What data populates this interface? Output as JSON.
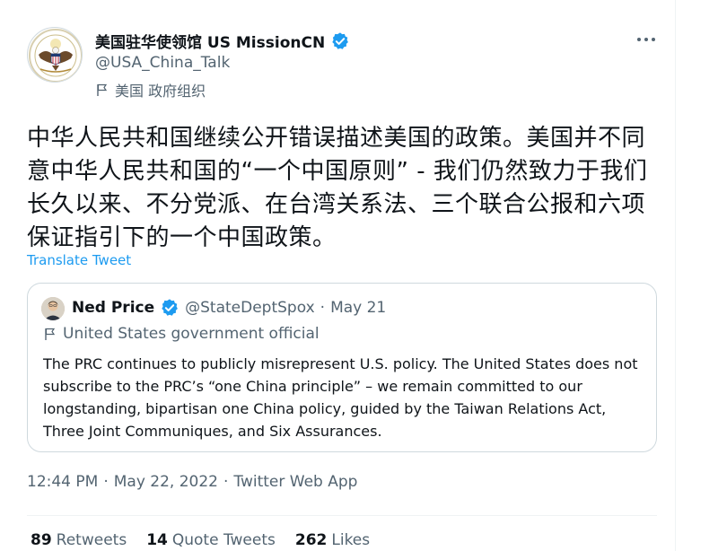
{
  "author": {
    "display_name": "美国驻华使领馆 US MissionCN",
    "handle": "@USA_China_Talk",
    "affiliation": "美国 政府组织"
  },
  "tweet": {
    "text": "中华人民共和国继续公开错误描述美国的政策。美国并不同意中华人民共和国的“一个中国原则” - 我们仍然致力于我们长久以来、不分党派、在台湾关系法、三个联合公报和六项保证指引下的一个中国政策。",
    "translate_label": "Translate Tweet",
    "time": "12:44 PM",
    "sep": "·",
    "date": "May 22, 2022",
    "source": "Twitter Web App"
  },
  "quote": {
    "display_name": "Ned Price",
    "handle": "@StateDeptSpox",
    "sep": "·",
    "date": "May 21",
    "affiliation": "United States government official",
    "text": "The PRC continues to publicly misrepresent U.S. policy. The United States does not subscribe to the PRC’s “one China principle” – we remain committed to our longstanding, bipartisan one China policy, guided by the Taiwan Relations Act, Three Joint Communiques, and Six Assurances."
  },
  "stats": {
    "retweets_count": "89",
    "retweets_label": "Retweets",
    "quotes_count": "14",
    "quotes_label": "Quote Tweets",
    "likes_count": "262",
    "likes_label": "Likes"
  },
  "colors": {
    "link": "#1d9bf0",
    "secondary_text": "#536471",
    "primary_text": "#0f1419",
    "verified": "#1d9bf0"
  },
  "icons": [
    "embassy-seal-avatar",
    "verified-badge-icon",
    "more-options-icon",
    "government-flag-icon",
    "profile-photo-avatar"
  ]
}
